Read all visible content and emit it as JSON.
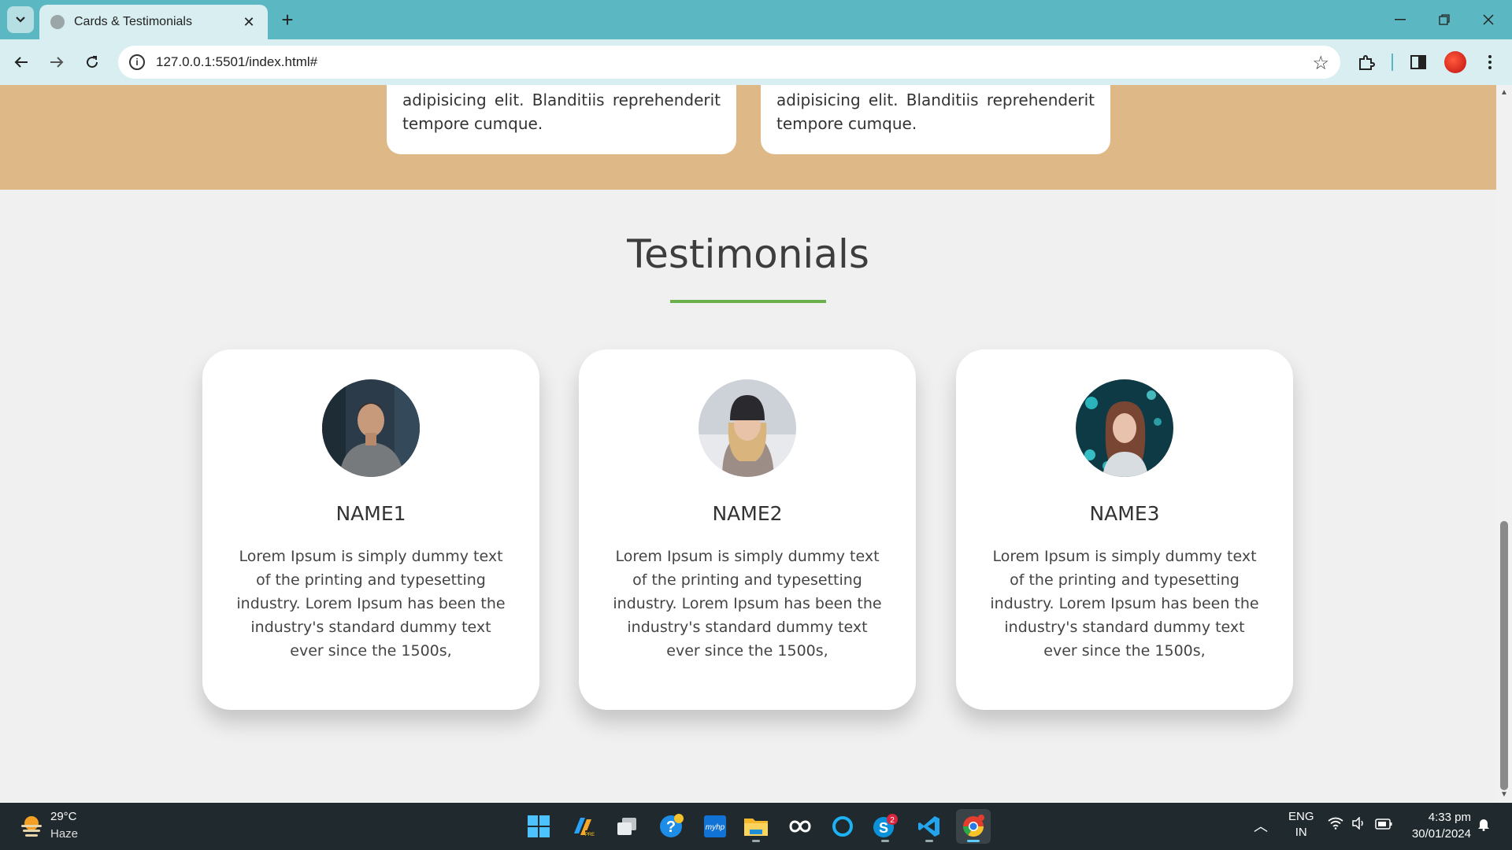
{
  "browser": {
    "tab_title": "Cards & Testimonials",
    "url": "127.0.0.1:5501/index.html#"
  },
  "cards": [
    {
      "text": "adipisicing elit. Blanditiis reprehenderit tempore cumque."
    },
    {
      "text": "adipisicing elit. Blanditiis reprehenderit tempore cumque."
    }
  ],
  "testimonials": {
    "title": "Testimonials",
    "accent_color": "#6ab04c",
    "items": [
      {
        "name": "NAME1",
        "text": "Lorem Ipsum is simply dummy text of the printing and typesetting industry. Lorem Ipsum has been the industry's standard dummy text ever since the 1500s,"
      },
      {
        "name": "NAME2",
        "text": "Lorem Ipsum is simply dummy text of the printing and typesetting industry. Lorem Ipsum has been the industry's standard dummy text ever since the 1500s,"
      },
      {
        "name": "NAME3",
        "text": "Lorem Ipsum is simply dummy text of the printing and typesetting industry. Lorem Ipsum has been the industry's standard dummy text ever since the 1500s,"
      }
    ]
  },
  "taskbar": {
    "weather_temp": "29°C",
    "weather_desc": "Haze",
    "lang_line1": "ENG",
    "lang_line2": "IN",
    "time": "4:33 pm",
    "date": "30/01/2024",
    "skype_badge": "2"
  },
  "colors": {
    "titlebar": "#5bb8c2",
    "cards_section_bg": "#dfb887",
    "page_bg": "#f0f0f0"
  }
}
